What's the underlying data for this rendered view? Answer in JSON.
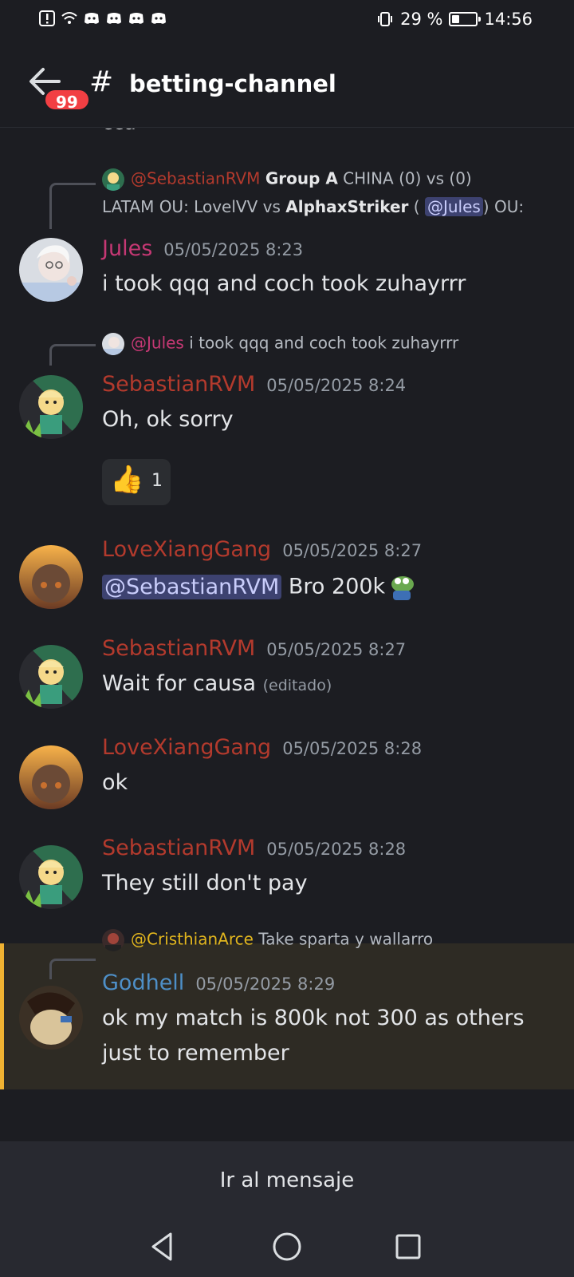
{
  "status": {
    "battery_percent": "29 %",
    "battery_level": 0.29,
    "time": "14:56"
  },
  "header": {
    "unread_badge": "99",
    "channel_hash": "#",
    "channel_name": "betting-channel"
  },
  "cut_text": "cca",
  "messages": [
    {
      "reply": {
        "mention": "@SebastianRVM",
        "bold1": "Group A",
        "text1": "  CHINA (0) vs (0)",
        "line2a": "LATAM  OU: LovelVV vs ",
        "bold2": "AlphaxStriker",
        "line2b": " ( ",
        "inline_mention": "@Jules",
        "line2c": ") OU:"
      },
      "author": "Jules",
      "author_color": "#c63874",
      "time": "05/05/2025 8:23",
      "text": "i took qqq and coch took zuhayrrr"
    },
    {
      "reply": {
        "mention": "@Jules",
        "text": "i took qqq and coch took zuhayrrr"
      },
      "author": "SebastianRVM",
      "author_color": "#b33a2d",
      "time": "05/05/2025 8:24",
      "text": "Oh, ok sorry",
      "reaction": {
        "emoji": "👍",
        "count": "1"
      }
    },
    {
      "author": "LoveXiangGang",
      "author_color": "#b33a2d",
      "time": "05/05/2025 8:27",
      "mention": "@SebastianRVM",
      "text": " Bro 200k"
    },
    {
      "author": "SebastianRVM",
      "author_color": "#b33a2d",
      "time": "05/05/2025 8:27",
      "text": "Wait for causa",
      "edited": "(editado)"
    },
    {
      "author": "LoveXiangGang",
      "author_color": "#b33a2d",
      "time": "05/05/2025 8:28",
      "text": "ok"
    },
    {
      "author": "SebastianRVM",
      "author_color": "#b33a2d",
      "time": "05/05/2025 8:28",
      "text": "They still don't pay"
    },
    {
      "reply": {
        "mention": "@CristhianArce",
        "text": "Take sparta y wallarro"
      },
      "author": "Godhell",
      "author_color": "#4e8fc7",
      "time": "05/05/2025 8:29",
      "text_line1": "ok my  match is 800k not 300 as others",
      "text_line2": "just to remember"
    }
  ],
  "jump_button": "Ir al mensaje",
  "icons": [
    "alert-icon",
    "wifi-icon",
    "discord-icon",
    "back-arrow-icon",
    "thumbs-up-icon",
    "nav-back-icon",
    "nav-home-icon",
    "nav-recents-icon"
  ]
}
